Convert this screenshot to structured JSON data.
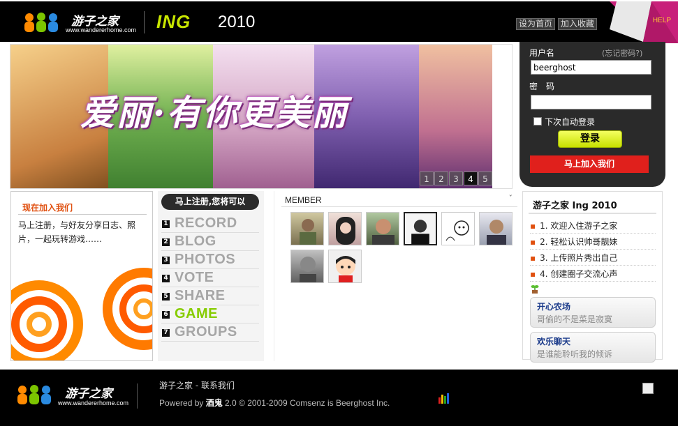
{
  "header": {
    "logo_text": "游子之家",
    "logo_url": "www.wandererhome.com",
    "ing": "ING",
    "year": "2010",
    "set_home": "设为首页",
    "add_favorite": "加入收藏",
    "help": "HELP"
  },
  "banner": {
    "title": "爱丽·有你更美丽",
    "pages": [
      "1",
      "2",
      "3",
      "4",
      "5"
    ],
    "active_page": "4"
  },
  "login": {
    "username_label": "用户名",
    "forgot": "(忘记密码?)",
    "username_value": "beerghost",
    "password_label": "密　码",
    "password_value": "",
    "remember_label": "下次自动登录",
    "login_button": "登录",
    "join_button": "马上加入我们"
  },
  "joinbox": {
    "title": "现在加入我们",
    "desc": "马上注册，与好友分享日志、照片，一起玩转游戏……"
  },
  "features": {
    "head": "马上注册,您将可以",
    "items": [
      {
        "num": "1",
        "label": "RECORD"
      },
      {
        "num": "2",
        "label": "BLOG"
      },
      {
        "num": "3",
        "label": "PHOTOS"
      },
      {
        "num": "4",
        "label": "VOTE"
      },
      {
        "num": "5",
        "label": "SHARE"
      },
      {
        "num": "6",
        "label": "GAME"
      },
      {
        "num": "7",
        "label": "GROUPS"
      }
    ]
  },
  "member": {
    "title": "MEMBER",
    "caret": "ˇ"
  },
  "right": {
    "title": "游子之家 Ing 2010",
    "news": [
      "1. 欢迎入住游子之家",
      "2. 轻松认识帅哥靓妹",
      "3. 上传照片秀出自己",
      "4. 创建圈子交流心声"
    ],
    "apps": [
      {
        "name": "开心农场",
        "desc": "哥偷的不是菜是寂寞"
      },
      {
        "name": "欢乐聊天",
        "desc": "是谁能聆听我的倾诉"
      }
    ]
  },
  "footer": {
    "logo_text": "游子之家",
    "logo_url": "www.wandererhome.com",
    "site_name": "游子之家",
    "contact": "联系我们",
    "powered_prefix": "Powered by ",
    "powered_brand": "酒鬼",
    "powered_suffix": " 2.0 © 2001-2009 Comsenz is Beerghost Inc."
  }
}
